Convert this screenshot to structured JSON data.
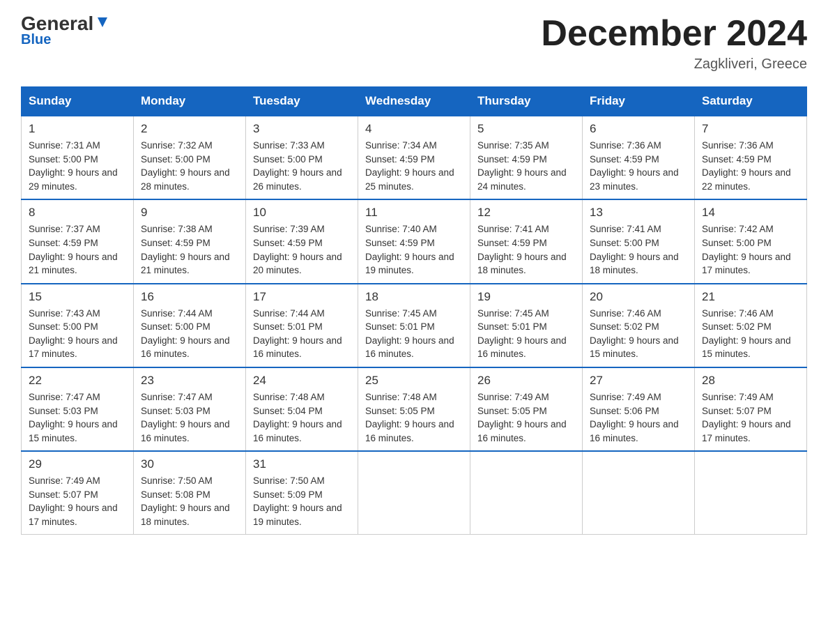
{
  "header": {
    "logo_general": "General",
    "logo_blue": "Blue",
    "month_title": "December 2024",
    "location": "Zagkliveri, Greece"
  },
  "days_of_week": [
    "Sunday",
    "Monday",
    "Tuesday",
    "Wednesday",
    "Thursday",
    "Friday",
    "Saturday"
  ],
  "weeks": [
    [
      {
        "day": "1",
        "sunrise": "7:31 AM",
        "sunset": "5:00 PM",
        "daylight": "9 hours and 29 minutes."
      },
      {
        "day": "2",
        "sunrise": "7:32 AM",
        "sunset": "5:00 PM",
        "daylight": "9 hours and 28 minutes."
      },
      {
        "day": "3",
        "sunrise": "7:33 AM",
        "sunset": "5:00 PM",
        "daylight": "9 hours and 26 minutes."
      },
      {
        "day": "4",
        "sunrise": "7:34 AM",
        "sunset": "4:59 PM",
        "daylight": "9 hours and 25 minutes."
      },
      {
        "day": "5",
        "sunrise": "7:35 AM",
        "sunset": "4:59 PM",
        "daylight": "9 hours and 24 minutes."
      },
      {
        "day": "6",
        "sunrise": "7:36 AM",
        "sunset": "4:59 PM",
        "daylight": "9 hours and 23 minutes."
      },
      {
        "day": "7",
        "sunrise": "7:36 AM",
        "sunset": "4:59 PM",
        "daylight": "9 hours and 22 minutes."
      }
    ],
    [
      {
        "day": "8",
        "sunrise": "7:37 AM",
        "sunset": "4:59 PM",
        "daylight": "9 hours and 21 minutes."
      },
      {
        "day": "9",
        "sunrise": "7:38 AM",
        "sunset": "4:59 PM",
        "daylight": "9 hours and 21 minutes."
      },
      {
        "day": "10",
        "sunrise": "7:39 AM",
        "sunset": "4:59 PM",
        "daylight": "9 hours and 20 minutes."
      },
      {
        "day": "11",
        "sunrise": "7:40 AM",
        "sunset": "4:59 PM",
        "daylight": "9 hours and 19 minutes."
      },
      {
        "day": "12",
        "sunrise": "7:41 AM",
        "sunset": "4:59 PM",
        "daylight": "9 hours and 18 minutes."
      },
      {
        "day": "13",
        "sunrise": "7:41 AM",
        "sunset": "5:00 PM",
        "daylight": "9 hours and 18 minutes."
      },
      {
        "day": "14",
        "sunrise": "7:42 AM",
        "sunset": "5:00 PM",
        "daylight": "9 hours and 17 minutes."
      }
    ],
    [
      {
        "day": "15",
        "sunrise": "7:43 AM",
        "sunset": "5:00 PM",
        "daylight": "9 hours and 17 minutes."
      },
      {
        "day": "16",
        "sunrise": "7:44 AM",
        "sunset": "5:00 PM",
        "daylight": "9 hours and 16 minutes."
      },
      {
        "day": "17",
        "sunrise": "7:44 AM",
        "sunset": "5:01 PM",
        "daylight": "9 hours and 16 minutes."
      },
      {
        "day": "18",
        "sunrise": "7:45 AM",
        "sunset": "5:01 PM",
        "daylight": "9 hours and 16 minutes."
      },
      {
        "day": "19",
        "sunrise": "7:45 AM",
        "sunset": "5:01 PM",
        "daylight": "9 hours and 16 minutes."
      },
      {
        "day": "20",
        "sunrise": "7:46 AM",
        "sunset": "5:02 PM",
        "daylight": "9 hours and 15 minutes."
      },
      {
        "day": "21",
        "sunrise": "7:46 AM",
        "sunset": "5:02 PM",
        "daylight": "9 hours and 15 minutes."
      }
    ],
    [
      {
        "day": "22",
        "sunrise": "7:47 AM",
        "sunset": "5:03 PM",
        "daylight": "9 hours and 15 minutes."
      },
      {
        "day": "23",
        "sunrise": "7:47 AM",
        "sunset": "5:03 PM",
        "daylight": "9 hours and 16 minutes."
      },
      {
        "day": "24",
        "sunrise": "7:48 AM",
        "sunset": "5:04 PM",
        "daylight": "9 hours and 16 minutes."
      },
      {
        "day": "25",
        "sunrise": "7:48 AM",
        "sunset": "5:05 PM",
        "daylight": "9 hours and 16 minutes."
      },
      {
        "day": "26",
        "sunrise": "7:49 AM",
        "sunset": "5:05 PM",
        "daylight": "9 hours and 16 minutes."
      },
      {
        "day": "27",
        "sunrise": "7:49 AM",
        "sunset": "5:06 PM",
        "daylight": "9 hours and 16 minutes."
      },
      {
        "day": "28",
        "sunrise": "7:49 AM",
        "sunset": "5:07 PM",
        "daylight": "9 hours and 17 minutes."
      }
    ],
    [
      {
        "day": "29",
        "sunrise": "7:49 AM",
        "sunset": "5:07 PM",
        "daylight": "9 hours and 17 minutes."
      },
      {
        "day": "30",
        "sunrise": "7:50 AM",
        "sunset": "5:08 PM",
        "daylight": "9 hours and 18 minutes."
      },
      {
        "day": "31",
        "sunrise": "7:50 AM",
        "sunset": "5:09 PM",
        "daylight": "9 hours and 19 minutes."
      },
      null,
      null,
      null,
      null
    ]
  ]
}
